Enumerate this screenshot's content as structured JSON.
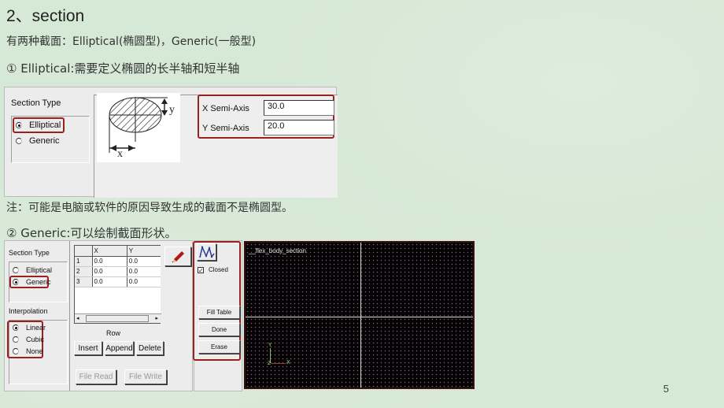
{
  "slide": {
    "title": "2、section",
    "line1": "有两种截面：Elliptical(椭圆型)，Generic(一般型)",
    "line2": "① Elliptical:需要定义椭圆的长半轴和短半轴",
    "note": "注：可能是电脑或软件的原因导致生成的截面不是椭圆型。",
    "line4": "② Generic:可以绘制截面形状。",
    "page_number": "5"
  },
  "elliptical_dialog": {
    "section_type_label": "Section Type",
    "options": [
      {
        "label": "Elliptical",
        "selected": true
      },
      {
        "label": "Generic",
        "selected": false
      }
    ],
    "figure_labels": {
      "x": "x",
      "y": "y"
    },
    "x_semi_axis_label": "X Semi-Axis",
    "x_semi_axis_value": "30.0",
    "y_semi_axis_label": "Y Semi-Axis",
    "y_semi_axis_value": "20.0"
  },
  "generic_dialog": {
    "section_type_label": "Section Type",
    "section_options": [
      {
        "label": "Elliptical",
        "selected": false
      },
      {
        "label": "Generic",
        "selected": true
      }
    ],
    "interpolation_label": "Interpolation",
    "interpolation_options": [
      {
        "label": "Linear",
        "selected": true
      },
      {
        "label": "Cubic",
        "selected": false
      },
      {
        "label": "None",
        "selected": false
      }
    ],
    "table": {
      "columns": [
        "X",
        "Y"
      ],
      "rows": [
        {
          "row": "1",
          "x": "0.0",
          "y": "0.0"
        },
        {
          "row": "2",
          "x": "0.0",
          "y": "0.0"
        },
        {
          "row": "3",
          "x": "0.0",
          "y": "0.0"
        }
      ]
    },
    "row_label": "Row",
    "buttons": {
      "insert": "Insert",
      "append": "Append",
      "delete": "Delete",
      "file_read": "File Read",
      "file_write": "File Write"
    },
    "closed_label": "Closed",
    "closed_checked": true,
    "fill_table": "Fill Table",
    "done": "Done",
    "erase": "Erase",
    "canvas_title": "__flex_body_section",
    "axis_x": "X",
    "axis_y": "Y",
    "axis_z": "Z"
  }
}
